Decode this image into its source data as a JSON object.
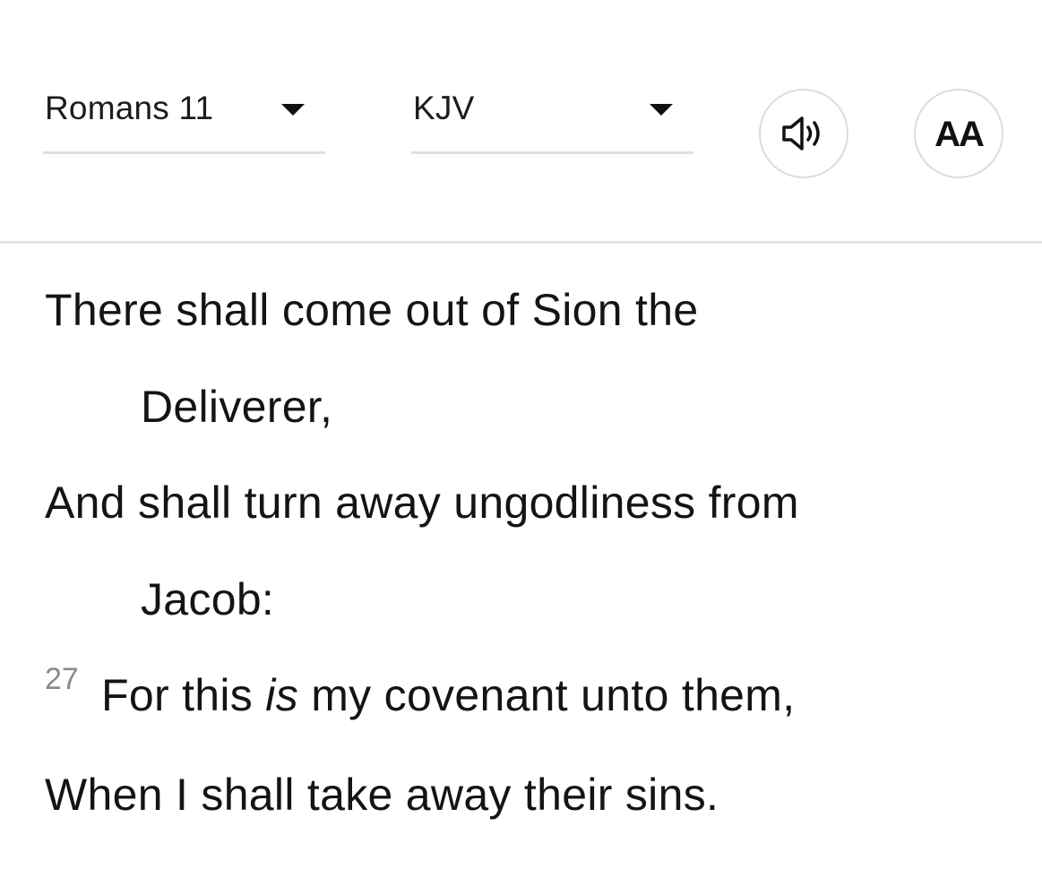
{
  "header": {
    "book_select": {
      "value": "Romans 11"
    },
    "version_select": {
      "value": "KJV"
    },
    "audio_button": {
      "icon": "speaker-icon"
    },
    "font_button": {
      "label": "AA"
    }
  },
  "passage": {
    "lines": [
      {
        "text": "There shall come out of Sion the"
      },
      {
        "text": "Deliverer,"
      },
      {
        "text": "And shall turn away ungodliness from"
      },
      {
        "text": "Jacob:"
      }
    ],
    "verse_27": {
      "number": "27",
      "before": "For this ",
      "italic": "is",
      "after": " my covenant unto them,"
    },
    "last_line": {
      "text": "When I shall take away their sins."
    }
  },
  "colors": {
    "text": "#141414",
    "verse_number": "#8a8a8a",
    "divider": "#e3e3e3",
    "button_border": "#dcdcdc"
  }
}
